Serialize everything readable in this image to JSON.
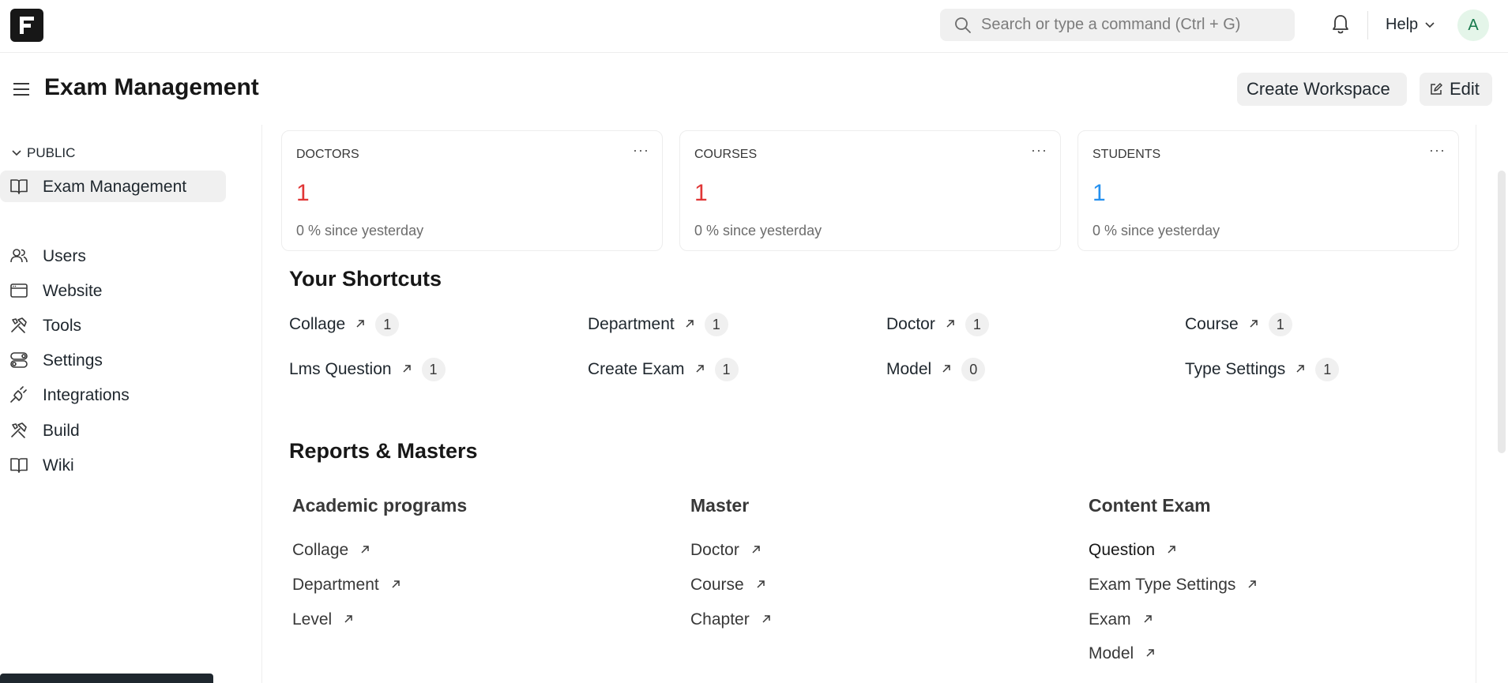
{
  "navbar": {
    "search_placeholder": "Search or type a command (Ctrl + G)",
    "help_label": "Help",
    "avatar_initial": "A"
  },
  "page": {
    "title": "Exam Management",
    "create_workspace_label": "Create Workspace",
    "edit_label": "Edit"
  },
  "sidebar": {
    "section_label": "PUBLIC",
    "public_items": [
      {
        "label": "Exam Management",
        "icon": "book-icon",
        "active": true
      }
    ],
    "items": [
      {
        "label": "Users",
        "icon": "users-icon"
      },
      {
        "label": "Website",
        "icon": "browser-window-icon"
      },
      {
        "label": "Tools",
        "icon": "tools-icon"
      },
      {
        "label": "Settings",
        "icon": "toggle-settings-icon"
      },
      {
        "label": "Integrations",
        "icon": "plug-icon"
      },
      {
        "label": "Build",
        "icon": "hammer-icon"
      },
      {
        "label": "Wiki",
        "icon": "book-icon"
      }
    ]
  },
  "number_cards": [
    {
      "title": "DOCTORS",
      "value": "1",
      "stat": "0 % since yesterday",
      "color": "#e03636"
    },
    {
      "title": "COURSES",
      "value": "1",
      "stat": "0 % since yesterday",
      "color": "#e03636"
    },
    {
      "title": "STUDENTS",
      "value": "1",
      "stat": "0 % since yesterday",
      "color": "#2490ef"
    }
  ],
  "shortcuts": {
    "title": "Your Shortcuts",
    "items": [
      {
        "label": "Collage",
        "count": "1"
      },
      {
        "label": "Department",
        "count": "1"
      },
      {
        "label": "Doctor",
        "count": "1"
      },
      {
        "label": "Course",
        "count": "1"
      },
      {
        "label": "Lms Question",
        "count": "1"
      },
      {
        "label": "Create Exam",
        "count": "1"
      },
      {
        "label": "Model",
        "count": "0"
      },
      {
        "label": "Type Settings",
        "count": "1"
      }
    ]
  },
  "reports": {
    "title": "Reports & Masters",
    "cards": [
      {
        "title": "Academic programs",
        "links": [
          "Collage",
          "Department",
          "Level"
        ]
      },
      {
        "title": "Master",
        "links": [
          "Doctor",
          "Course",
          "Chapter"
        ]
      },
      {
        "title": "Content Exam",
        "links": [
          "Question",
          "Exam Type Settings",
          "Exam",
          "Model"
        ]
      }
    ]
  }
}
